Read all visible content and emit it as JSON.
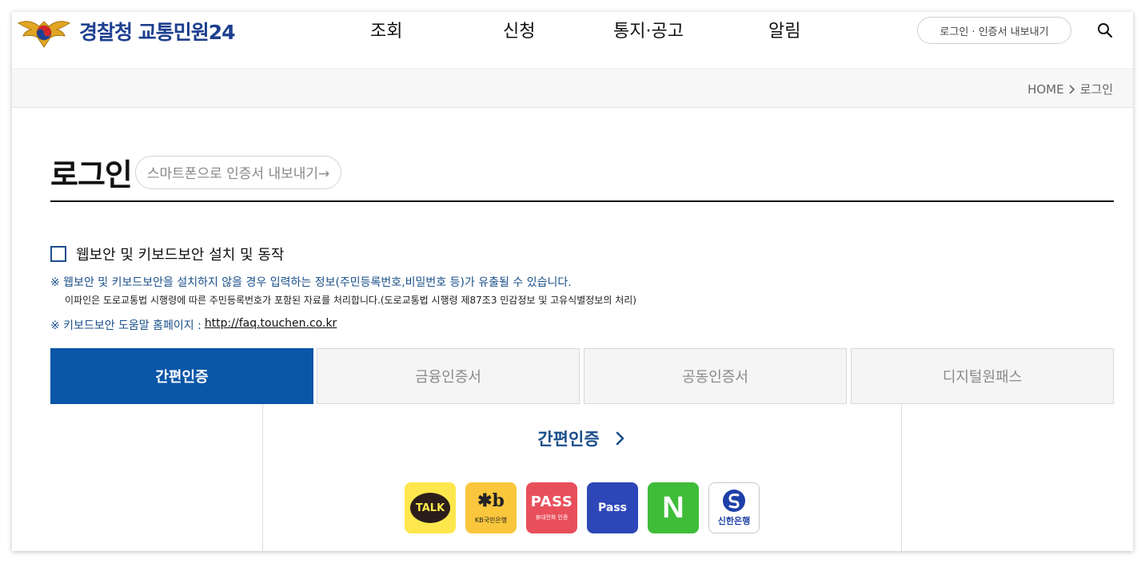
{
  "header": {
    "brand": "경찰청 교통민원24",
    "nav": [
      "조회",
      "신청",
      "통지·공고",
      "알림"
    ],
    "login_link": "로그인 · 인증서 내보내기"
  },
  "breadcrumb": {
    "home": "HOME",
    "current": "로그인"
  },
  "page": {
    "title": "로그인",
    "export_link": "스마트폰으로 인증서 내보내기→"
  },
  "security": {
    "checkbox_label": "웹보안 및 키보드보안 설치 및 동작",
    "checked": false,
    "warning": "※ 웹보안 및 키보드보안을 설치하지 않을 경우 입력하는 정보(주민등록번호,비밀번호 등)가 유출될 수 있습니다.",
    "privacy": "이파인은 도로교통법 시행령에 따른 주민등록번호가 포함된 자료를 처리합니다.(도로교통법 시행령 제87조3 민감정보 및 고유식별정보의 처리)",
    "help_label": "※ 키보드보안 도움말 홈페이지 :",
    "help_url": "http://faq.touchen.co.kr"
  },
  "tabs": [
    {
      "label": "간편인증",
      "active": true
    },
    {
      "label": "금융인증서",
      "active": false
    },
    {
      "label": "공동인증서",
      "active": false
    },
    {
      "label": "디지털원패스",
      "active": false
    }
  ],
  "panel": {
    "title": "간편인증",
    "providers": {
      "kakao": "TALK",
      "kb_mark": "✱b",
      "kb_sub": "KB국민은행",
      "pass_big": "PASS",
      "pass_sub": "휴대전화 인증",
      "pass2": "Pass",
      "naver": "N",
      "shinhan_sub": "신한은행"
    }
  },
  "colors": {
    "primary": "#0a56a7",
    "brand": "#1d3f8f",
    "notice": "#1a4f8a"
  }
}
